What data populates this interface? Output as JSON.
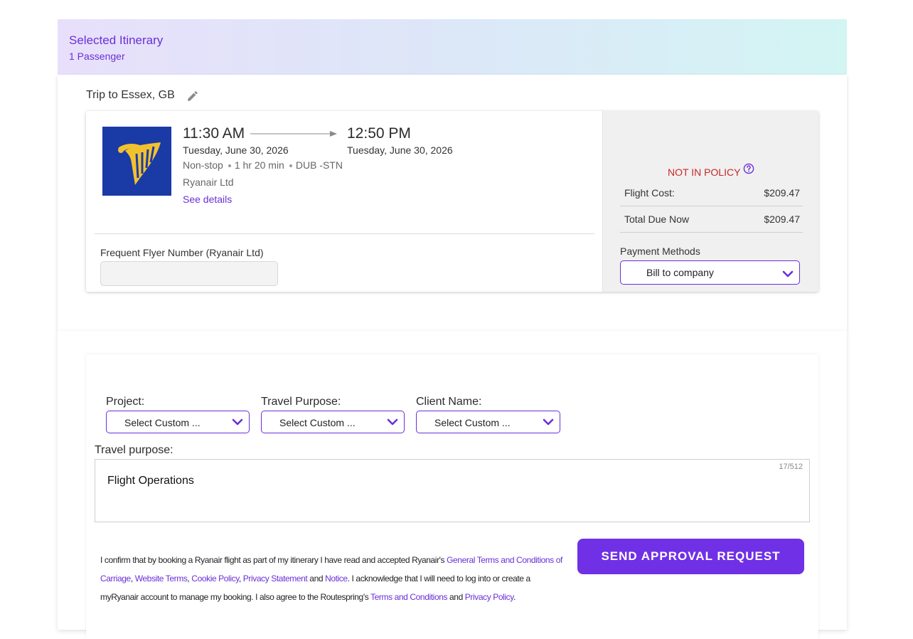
{
  "itinerary": {
    "title": "Selected Itinerary",
    "passengers": "1 Passenger"
  },
  "trip": {
    "title": "Trip to Essex, GB"
  },
  "flight": {
    "airline_logo": "ryanair-harp-logo",
    "departure_time": "11:30 AM",
    "arrival_time": "12:50 PM",
    "departure_date": "Tuesday, June 30, 2026",
    "arrival_date": "Tuesday, June 30, 2026",
    "stops": "Non-stop",
    "duration": "1 hr 20 min",
    "route": "DUB -STN",
    "airline": "Ryanair Ltd",
    "details_link": "See details"
  },
  "frequent_flyer": {
    "label": "Frequent Flyer Number (Ryanair Ltd)",
    "value": "",
    "placeholder": ""
  },
  "pricing": {
    "policy_status": "NOT IN POLICY",
    "flight_cost_label": "Flight Cost:",
    "flight_cost": "$209.47",
    "total_label": "Total Due Now",
    "total": "$209.47",
    "payment_label": "Payment Methods",
    "payment_selected": "Bill to company"
  },
  "custom_fields": [
    {
      "label": "Project:",
      "selected": "Select Custom ..."
    },
    {
      "label": "Travel Purpose:",
      "selected": "Select Custom ..."
    },
    {
      "label": "Client Name:",
      "selected": "Select Custom ..."
    }
  ],
  "travel_purpose": {
    "label": "Travel purpose:",
    "value": "Flight Operations",
    "counter": "17/512"
  },
  "consent": {
    "t1": "I confirm that by booking a Ryanair flight as part of my itinerary I have read and accepted Ryanair's ",
    "l1": "General Terms and Conditions of Carriage",
    "t2": ", ",
    "l2": "Website Terms",
    "t3": ", ",
    "l3": "Cookie Policy",
    "t4": ", ",
    "l4": "Privacy Statement",
    "t5": " and ",
    "l5": "Notice",
    "t6": ". I acknowledge that I will need to log into or create a myRyanair account to manage my booking. I also agree to the Routespring's ",
    "l6": "Terms and Conditions",
    "t7": " and ",
    "l7": "Privacy Policy",
    "t8": "."
  },
  "actions": {
    "send_label": "SEND APPROVAL REQUEST"
  },
  "colors": {
    "accent": "#6a2fd8",
    "button": "#7030e6",
    "policy_warning": "#c62828",
    "airline_logo_bg": "#1a3aa6"
  },
  "icons": {
    "edit": "pencil-icon",
    "help": "question-circle-icon",
    "dropdown": "chevron-down-icon"
  }
}
